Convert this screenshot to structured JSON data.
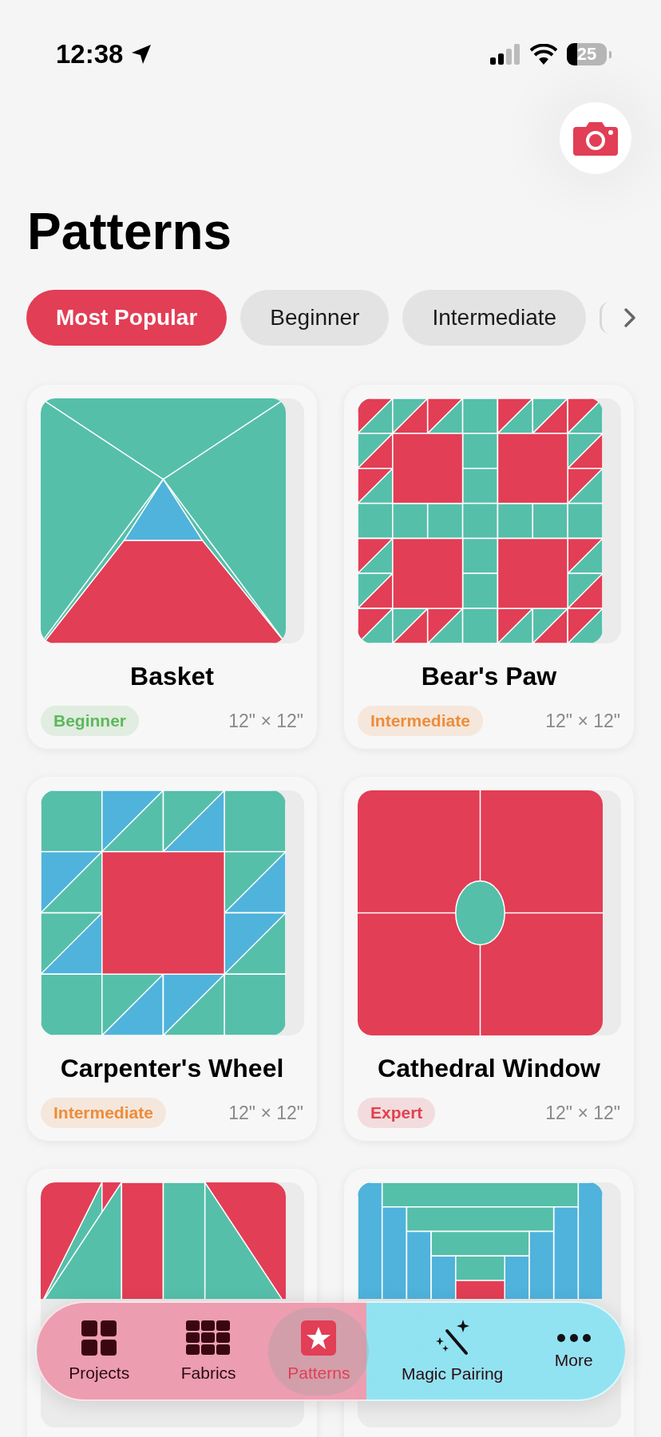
{
  "status_bar": {
    "time": "12:38",
    "battery": "25"
  },
  "page": {
    "title": "Patterns"
  },
  "filters": [
    {
      "label": "Most Popular",
      "selected": true
    },
    {
      "label": "Beginner",
      "selected": false
    },
    {
      "label": "Intermediate",
      "selected": false
    }
  ],
  "patterns": [
    {
      "name": "Basket",
      "kind": "basket",
      "difficulty": {
        "label": "Beginner",
        "color": "#5cb85c"
      },
      "size": "12\" × 12\""
    },
    {
      "name": "Bear's Paw",
      "kind": "bears-paw",
      "difficulty": {
        "label": "Intermediate",
        "color": "#ee8c3a"
      },
      "size": "12\" × 12\""
    },
    {
      "name": "Carpenter's Wheel",
      "kind": "carpenters-wheel",
      "difficulty": {
        "label": "Intermediate",
        "color": "#ee8c3a"
      },
      "size": "12\" × 12\""
    },
    {
      "name": "Cathedral Window",
      "kind": "cathedral-window",
      "difficulty": {
        "label": "Expert",
        "color": "#e0424f"
      },
      "size": "12\" × 12\""
    },
    {
      "kind": "half-square"
    },
    {
      "kind": "log-cabin"
    }
  ],
  "tab_bar": [
    {
      "label": "Projects",
      "kind": "projects",
      "selected": false
    },
    {
      "label": "Fabrics",
      "kind": "fabrics",
      "selected": false
    },
    {
      "label": "Patterns",
      "kind": "patterns",
      "selected": true
    },
    {
      "label": "Magic Pairing",
      "kind": "magic",
      "selected": false
    },
    {
      "label": "More",
      "kind": "more",
      "selected": false
    }
  ]
}
